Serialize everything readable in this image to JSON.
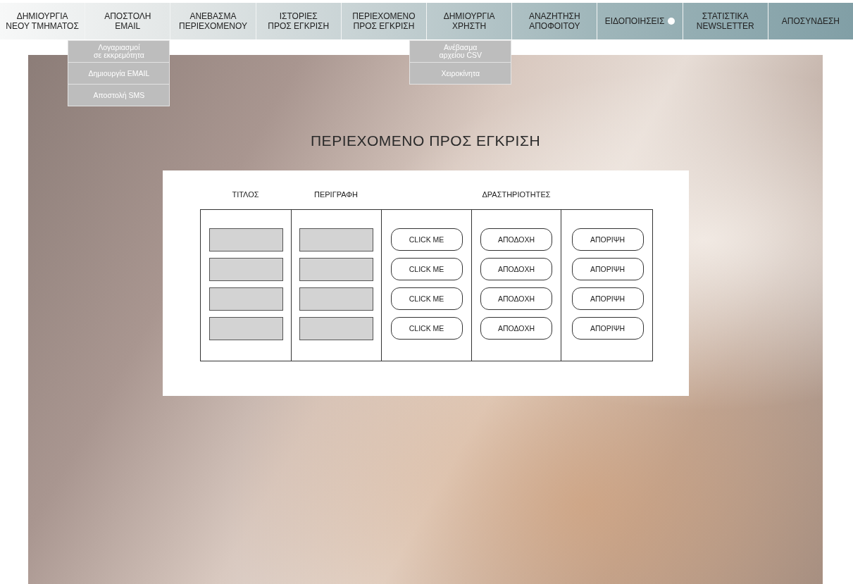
{
  "nav": {
    "items": [
      {
        "label": "ΔΗΜΙΟΥΡΓΙΑ\nΝΕΟΥ ΤΜΗΜΑΤΟΣ",
        "notification": false
      },
      {
        "label": "ΑΠΟΣΤΟΛΗ\nEMAIL",
        "notification": false,
        "submenu": [
          "Λογαριασμοί\nσε εκκρεμότητα",
          "Δημιουργία EMAIL",
          "Αποστολή SMS"
        ]
      },
      {
        "label": "ΑΝΕΒΑΣΜΑ\nΠΕΡΙΕΧΟΜΕΝΟΥ",
        "notification": false
      },
      {
        "label": "ΙΣΤΟΡΙΕΣ\nΠΡΟΣ ΕΓΚΡΙΣΗ",
        "notification": false
      },
      {
        "label": "ΠΕΡΙΕΧΟΜΕΝΟ\nΠΡΟΣ ΕΓΚΡΙΣΗ",
        "notification": false
      },
      {
        "label": "ΔΗΜΙΟΥΡΓΙΑ\nΧΡΗΣΤΗ",
        "notification": false,
        "submenu": [
          "Ανέβασμα\nαρχείου CSV",
          "Χειροκίνητα"
        ]
      },
      {
        "label": "ΑΝΑΖΗΤΗΣΗ\nΑΠΟΦΟΙΤΟΥ",
        "notification": false
      },
      {
        "label": "ΕΙΔΟΠΟΙΗΣΕΙΣ",
        "notification": true
      },
      {
        "label": "ΣΤΑΤΙΣΤΙΚΑ\nNEWSLETTER",
        "notification": false
      },
      {
        "label": "ΑΠΟΣΥΝΔΕΣΗ",
        "notification": false
      }
    ]
  },
  "page_title": "ΠΕΡΙΕΧΟΜΕΝΟ ΠΡΟΣ ΕΓΚΡΙΣΗ",
  "table": {
    "columns": [
      "ΤΙΤΛΟΣ",
      "ΠΕΡΙΓΡΑΦΗ",
      "ΔΡΑΣΤΗΡΙΟΤΗΤΕΣ"
    ],
    "rows": [
      {
        "action": "CLICK ME",
        "accept": "ΑΠΟΔΟΧΗ",
        "reject": "ΑΠΟΡΙΨΗ"
      },
      {
        "action": "CLICK ME",
        "accept": "ΑΠΟΔΟΧΗ",
        "reject": "ΑΠΟΡΙΨΗ"
      },
      {
        "action": "CLICK ME",
        "accept": "ΑΠΟΔΟΧΗ",
        "reject": "ΑΠΟΡΙΨΗ"
      },
      {
        "action": "CLICK ME",
        "accept": "ΑΠΟΔΟΧΗ",
        "reject": "ΑΠΟΡΙΨΗ"
      }
    ]
  }
}
